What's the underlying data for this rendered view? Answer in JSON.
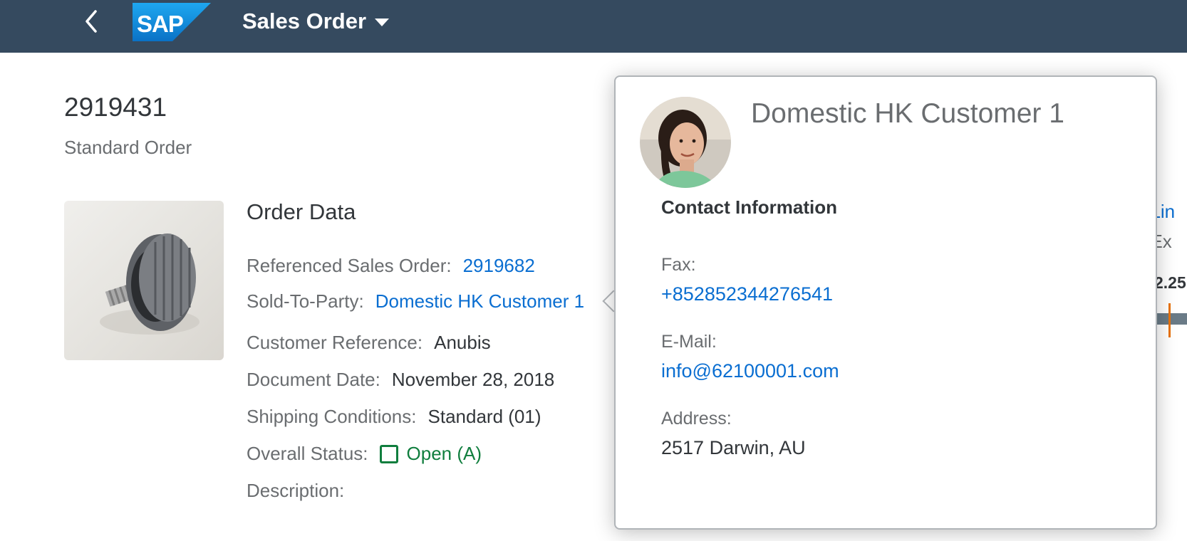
{
  "shell": {
    "app_title": "Sales Order",
    "logo_text": "SAP",
    "colors": {
      "shell_bg": "#354a5f",
      "logo_blue": "#0a8fe0"
    }
  },
  "header": {
    "title": "2919431",
    "subtitle": "Standard Order"
  },
  "order_data": {
    "section_title": "Order Data",
    "fields": [
      {
        "label": "Referenced Sales Order:",
        "value": "2919682",
        "type": "link"
      },
      {
        "label": "Sold-To-Party:",
        "value": "Domestic HK Customer 1",
        "type": "link"
      },
      {
        "label": "Customer Reference:",
        "value": "Anubis",
        "type": "text"
      },
      {
        "label": "Document Date:",
        "value": "November 28, 2018",
        "type": "text"
      },
      {
        "label": "Shipping Conditions:",
        "value": "Standard (01)",
        "type": "text"
      },
      {
        "label": "Overall Status:",
        "value": "Open (A)",
        "type": "status"
      },
      {
        "label": "Description:",
        "value": "",
        "type": "text"
      }
    ]
  },
  "peek": {
    "link_text": "t Lin",
    "text": "t Ex",
    "number": "2.25"
  },
  "popover": {
    "title": "Domestic HK Customer 1",
    "section_title": "Contact Information",
    "fax_label": "Fax:",
    "fax_value": "+852852344276541",
    "email_label": "E-Mail:",
    "email_value": "info@62100001.com",
    "address_label": "Address:",
    "address_value": "2517 Darwin, AU"
  },
  "icons": {
    "back": "chevron-left-icon",
    "dropdown": "triangle-down-icon",
    "status": "status-square-icon"
  }
}
